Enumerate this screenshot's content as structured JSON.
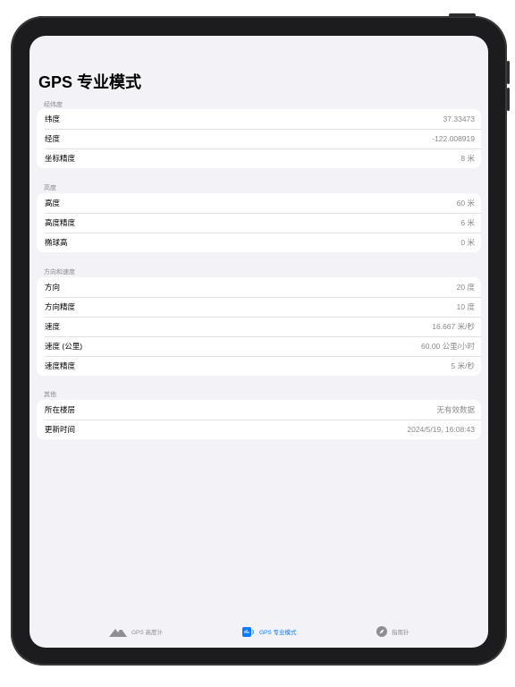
{
  "page": {
    "title": "GPS 专业模式"
  },
  "sections": [
    {
      "header": "经纬度",
      "rows": [
        {
          "label": "纬度",
          "value": "37.33473"
        },
        {
          "label": "经度",
          "value": "-122.008919"
        },
        {
          "label": "坐标精度",
          "value": "8 米"
        }
      ]
    },
    {
      "header": "高度",
      "rows": [
        {
          "label": "高度",
          "value": "60 米"
        },
        {
          "label": "高度精度",
          "value": "6 米"
        },
        {
          "label": "椭球高",
          "value": "0 米"
        }
      ]
    },
    {
      "header": "方向和速度",
      "rows": [
        {
          "label": "方向",
          "value": "20 度"
        },
        {
          "label": "方向精度",
          "value": "10 度"
        },
        {
          "label": "速度",
          "value": "16.667 米/秒"
        },
        {
          "label": "速度 (公里)",
          "value": "60.00 公里/小时"
        },
        {
          "label": "速度精度",
          "value": "5 米/秒"
        }
      ]
    },
    {
      "header": "其他",
      "rows": [
        {
          "label": "所在楼层",
          "value": "无有效数据"
        },
        {
          "label": "更新时间",
          "value": "2024/5/19, 16:08:43"
        }
      ]
    }
  ],
  "tabbar": {
    "active_color": "#0a7aff",
    "inactive_color": "#8e8e93",
    "tabs": [
      {
        "label": "GPS 高度计",
        "icon": "mountain-icon",
        "active": false
      },
      {
        "label": "GPS 专业模式",
        "icon": "gps-signal-icon",
        "active": true
      },
      {
        "label": "指南针",
        "icon": "compass-icon",
        "active": false
      }
    ]
  }
}
